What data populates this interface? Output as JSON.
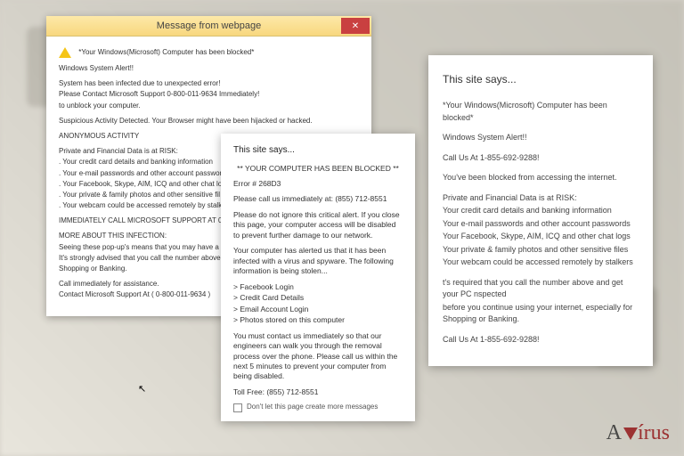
{
  "dialog1": {
    "titlebar": "Message from webpage",
    "close": "✕",
    "heading": "*Your Windows(Microsoft) Computer has been blocked*",
    "alert": "Windows System Alert!!",
    "line1": "System has been infected due to unexpected error!",
    "line2": "Please Contact Microsoft Support 0-800-011-9634 Immediately!",
    "line3": "to unblock your computer.",
    "suspicious": "Suspicious Activity Detected. Your Browser might have been hijacked or hacked.",
    "anon": "ANONYMOUS ACTIVITY",
    "risk": "Private and Financial Data is at RISK:",
    "r1": ". Your credit card details and banking information",
    "r2": ". Your e-mail passwords and other account passwords",
    "r3": ". Your Facebook, Skype, AIM, ICQ and other chat log",
    "r4": ". Your private & family photos and other sensitive fil",
    "r5": ". Your webcam could be accessed remotely by stalke",
    "call": "IMMEDIATELY CALL MICROSOFT SUPPORT AT 0-8",
    "more": "MORE ABOUT THIS INFECTION:",
    "m1": "Seeing these pop-up's means that you may have a v",
    "m2": "It's strongly advised that you call the number above",
    "m3": "Shopping or Banking.",
    "call2a": "Call immediately for assistance.",
    "call2b": "Contact Microsoft Support At ( 0-800-011-9634 )"
  },
  "dialog2": {
    "title": "This site says...",
    "h1": "** YOUR COMPUTER HAS BEEN BLOCKED **",
    "err": "Error # 268D3",
    "call": "Please call us immediately at: (855) 712-8551",
    "p1": "Please do not ignore this critical alert. If you close this page, your computer access will be disabled to prevent further damage to our network.",
    "p2": "Your computer has alerted us that it has been infected with a virus and spyware. The following information is being stolen...",
    "l1": "> Facebook Login",
    "l2": "> Credit Card Details",
    "l3": "> Email Account Login",
    "l4": "> Photos stored on this computer",
    "p3": "You must contact us immediately so that our engineers can walk you through the removal process over the phone. Please call us within the next 5 minutes to prevent your computer from being disabled.",
    "toll": "Toll Free: (855) 712-8551",
    "chk": "Don't let this page create more messages"
  },
  "dialog3": {
    "title": "This site says...",
    "h1": "*Your Windows(Microsoft) Computer has been blocked*",
    "alert": "Windows System Alert!!",
    "call1": "Call Us At 1-855-692-9288!",
    "b1": "You've been blocked from accessing the internet.",
    "risk": "Private and Financial Data is at RISK:",
    "r1": "Your credit card details and banking information",
    "r2": "Your e-mail passwords and other account passwords",
    "r3": "Your Facebook, Skype, AIM, ICQ and other chat logs",
    "r4": "Your private & family photos and other sensitive files",
    "r5": "Your webcam could be accessed remotely by stalkers",
    "req1": "t's required that you call the number above and get your PC nspected",
    "req2": "before you continue using your internet, especially for Shopping or Banking.",
    "call2": "Call Us At 1-855-692-9288!"
  },
  "watermark": {
    "a": "A",
    "v": "írus"
  }
}
